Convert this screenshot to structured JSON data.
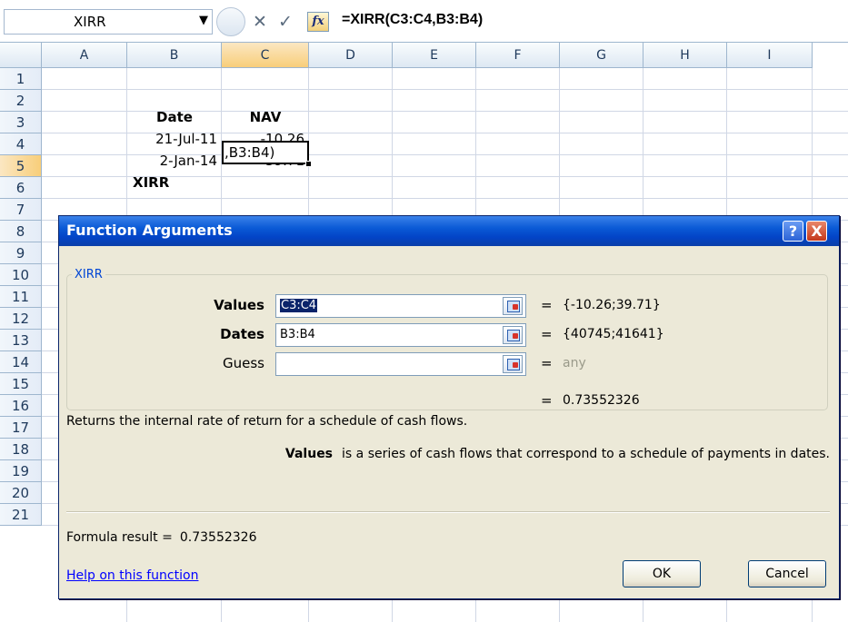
{
  "formula_bar": {
    "name_box": "XIRR",
    "cancel_glyph": "✕",
    "enter_glyph": "✓",
    "insert_function_label": "fx",
    "formula": "=XIRR(C3:C4,B3:B4)"
  },
  "sheet": {
    "columns": [
      "A",
      "B",
      "C",
      "D",
      "E",
      "F",
      "G",
      "H",
      "I"
    ],
    "rows": [
      "1",
      "2",
      "3",
      "4",
      "5",
      "6",
      "7",
      "8",
      "9",
      "10",
      "11",
      "12",
      "13",
      "14",
      "15",
      "16",
      "17",
      "18",
      "19",
      "20",
      "21"
    ],
    "selected_column": "C",
    "selected_row": "5",
    "cells": {
      "B2": "Date",
      "C2": "NAV",
      "B3": "21-Jul-11",
      "C3": "-10.26",
      "B4": "2-Jan-14",
      "C4": "39.71",
      "B5": "XIRR",
      "C5": ",B3:B4)"
    }
  },
  "dialog": {
    "title": "Function Arguments",
    "help_glyph": "?",
    "close_glyph": "X",
    "group_label": "XIRR",
    "args": [
      {
        "label": "Values",
        "value": "C3:C4",
        "eq": "=",
        "result": "{-10.26;39.71}",
        "bold": true,
        "selected": true
      },
      {
        "label": "Dates",
        "value": "B3:B4",
        "eq": "=",
        "result": "{40745;41641}",
        "bold": true,
        "selected": false
      },
      {
        "label": "Guess",
        "value": "",
        "eq": "=",
        "result": "any",
        "bold": false,
        "selected": false
      }
    ],
    "result_eq": "=",
    "result_value": "0.73552326",
    "description": "Returns the internal rate of return for a schedule of cash flows.",
    "arg_desc_name": "Values",
    "arg_desc_text": "is a series of cash flows that correspond to a schedule of payments in dates.",
    "formula_result_label": "Formula result =",
    "formula_result_value": "0.73552326",
    "help_link": "Help on this function",
    "ok_label": "OK",
    "cancel_label": "Cancel"
  }
}
